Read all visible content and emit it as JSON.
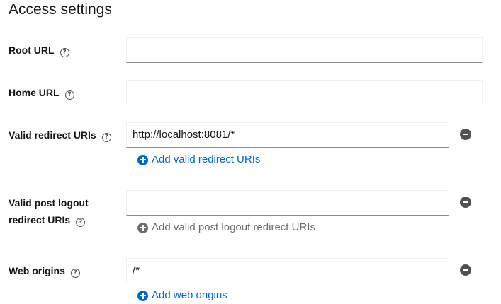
{
  "section": {
    "title": "Access settings"
  },
  "fields": {
    "root_url": {
      "label": "Root URL",
      "value": ""
    },
    "home_url": {
      "label": "Home URL",
      "value": ""
    },
    "valid_redirect_uris": {
      "label": "Valid redirect URIs",
      "value": "http://localhost:8081/*",
      "add_label": "Add valid redirect URIs"
    },
    "valid_post_logout": {
      "label_line1": "Valid post logout",
      "label_line2": "redirect URIs",
      "value": "",
      "add_label": "Add valid post logout redirect URIs"
    },
    "web_origins": {
      "label": "Web origins",
      "value": "/*",
      "add_label": "Add web origins"
    }
  },
  "colors": {
    "link": "#0066cc",
    "disabled": "#6a6e73",
    "icon": "#4f5255"
  }
}
